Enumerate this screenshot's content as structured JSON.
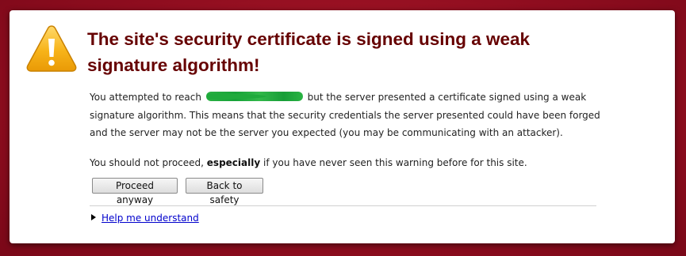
{
  "page": {
    "background_color": "#8e0c1e",
    "title_color": "#660000",
    "link_color": "#0000cc"
  },
  "warning": {
    "icon": "warning-triangle-icon",
    "title": "The site's security certificate is signed using a weak signature algorithm!",
    "para1_before": "You attempted to reach",
    "para1_after": "but the server presented a certificate signed using a weak signature algorithm. This means that the security credentials the server presented could have been forged and the server may not be the server you expected (you may be communicating with an attacker).",
    "para2_before": "You should not proceed,",
    "para2_emphasis": "especially",
    "para2_after": "if you have never seen this warning before for this site."
  },
  "buttons": {
    "proceed_label": "Proceed anyway",
    "safety_label": "Back to safety"
  },
  "help": {
    "disclosure_icon": "triangle-right-icon",
    "link_label": "Help me understand"
  }
}
